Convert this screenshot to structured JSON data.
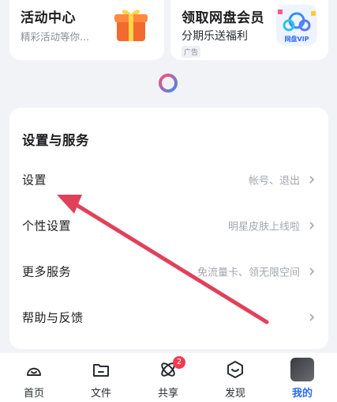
{
  "promos": {
    "left": {
      "title": "活动中心",
      "subtitle": "精彩活动等你..."
    },
    "right": {
      "title": "领取网盘会员",
      "subtitle": "分期乐送福利",
      "ad_tag": "广告",
      "badge_text": "网盘VIP"
    }
  },
  "services": {
    "title": "设置与服务",
    "rows": [
      {
        "label": "设置",
        "hint": "帐号、退出"
      },
      {
        "label": "个性设置",
        "hint": "明星皮肤上线啦"
      },
      {
        "label": "更多服务",
        "hint": "免流量卡、领无限空间"
      },
      {
        "label": "帮助与反馈",
        "hint": ""
      }
    ]
  },
  "tabbar": {
    "items": [
      {
        "label": "首页",
        "icon": "home-icon"
      },
      {
        "label": "文件",
        "icon": "folder-icon"
      },
      {
        "label": "共享",
        "icon": "share-icon",
        "badge": "2"
      },
      {
        "label": "发现",
        "icon": "discover-icon"
      },
      {
        "label": "我的",
        "icon": "avatar",
        "active": true
      }
    ]
  },
  "colors": {
    "accent": "#2d6df6",
    "badge": "#f23b4e",
    "arrow": "#e0415a"
  }
}
